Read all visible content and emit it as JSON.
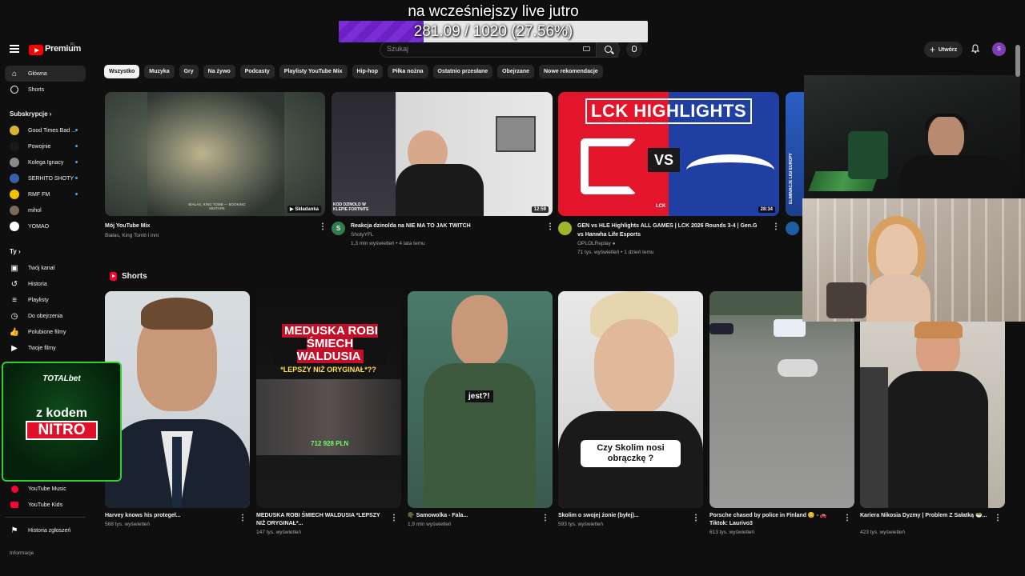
{
  "overlay": {
    "title": "na wcześniejszy live jutro",
    "progress_text": "281.09 / 1020 (27.56%)",
    "progress_fraction": 0.2756
  },
  "header": {
    "logo_text": "Premium",
    "logo_region": "PL",
    "search_placeholder": "Szukaj",
    "create_label": "Utwórz",
    "avatar_letter": "S"
  },
  "sidebar": {
    "primary": [
      {
        "label": "Główna",
        "icon": "home-icon"
      },
      {
        "label": "Shorts",
        "icon": "shorts-icon"
      }
    ],
    "subs_header": "Subskrypcje",
    "subscriptions": [
      {
        "label": "Good Times Bad ...",
        "color": "#d9b233",
        "dot": true
      },
      {
        "label": "Powojnie",
        "color": "#1a1a1a",
        "dot": true
      },
      {
        "label": "Kolega Ignacy",
        "color": "#8a8a8a",
        "dot": true
      },
      {
        "label": "SERHITO SHOTY",
        "color": "#3a5fa8",
        "dot": true
      },
      {
        "label": "RMF FM",
        "color": "#f2c200",
        "dot": true
      },
      {
        "label": "mihol",
        "color": "#7a6a5a",
        "dot": false
      },
      {
        "label": "YOMAO",
        "color": "#ffffff",
        "dot": false
      }
    ],
    "you_header": "Ty",
    "you_items": [
      {
        "label": "Twój kanał",
        "icon": "channel-icon"
      },
      {
        "label": "Historia",
        "icon": "history-icon"
      },
      {
        "label": "Playlisty",
        "icon": "playlist-icon"
      },
      {
        "label": "Do obejrzenia",
        "icon": "watch-later-icon"
      },
      {
        "label": "Polubione filmy",
        "icon": "like-icon"
      },
      {
        "label": "Twoje filmy",
        "icon": "your-videos-icon"
      }
    ],
    "more": [
      {
        "label": "YouTube Music",
        "icon": "youtube-music-icon"
      },
      {
        "label": "YouTube Kids",
        "icon": "youtube-kids-icon"
      }
    ],
    "report": "Historia zgłoszeń",
    "info": "Informacje"
  },
  "chips": [
    "Wszystko",
    "Muzyka",
    "Gry",
    "Na żywo",
    "Podcasty",
    "Playlisty YouTube Mix",
    "Hip-hop",
    "Piłka nożna",
    "Ostatnio przesłane",
    "Obejrzane",
    "Nowe rekomendacje"
  ],
  "videos": [
    {
      "title": "Mój YouTube Mix",
      "meta": "Białas, King Tomb i inni",
      "badge": "Składanka",
      "thumb_text": "BIAŁAS, KING TOMB — BOOKING MIXTAPE"
    },
    {
      "title": "Reakcja dzinolda na NIE MA TO JAK TWITCH",
      "channel": "ShotyYFL",
      "meta": "1,3 mln wyświetleń • 4 lata temu",
      "duration": "12:59",
      "thumb_text": "KOD DZINOLD W KLEPIE FORTNITE"
    },
    {
      "title_line1": "GEN vs HLE Highlights ALL GAMES | LCK 2026 Rounds 3-4 | Gen.G",
      "title_line2": "vs Hanwha Life Esports",
      "channel": "OPLOLReplay",
      "meta": "71 tys. wyświetleń • 1 dzień temu",
      "duration": "28:34",
      "thumb_heading": "LCK HIGHLIGHTS",
      "thumb_vs": "VS",
      "thumb_logo": "LCK"
    }
  ],
  "partial_thumb_text": "ELIMINACJE LIGI EUROPY",
  "shorts_header": "Shorts",
  "shorts": [
    {
      "title": "Harvey knows his protegeł...",
      "meta": "568 tys. wyświetleń"
    },
    {
      "title": "MEDUSKA ROBI ŚMIECH WALDUSIA *LEPSZY NIŻ ORYGINAŁ*...",
      "meta": "147 tys. wyświetleń",
      "thumb_heading": "MEDUSKA ROBI ŚMIECH WALDUSIA",
      "thumb_sub": "*LEPSZY NIŻ ORYGINAŁ*??",
      "thumb_money": "712 928 PLN"
    },
    {
      "title": "🪖 Samowolka - Fala...",
      "meta": "1,9 mln wyświetleń",
      "thumb_caption": "jest?!"
    },
    {
      "title": "Skolim o swojej żonie (byłej)...",
      "meta": "593 tys. wyświetleń",
      "thumb_caption": "Czy Skolim nosi obrączkę ?"
    },
    {
      "title": "Porsche chased by police in Finland 😊 - 🚗 Tiktok: Laurivo3",
      "meta": "613 tys. wyświetleń"
    },
    {
      "title": "Kariera Nikosia Dyzmy | Problem Z Sałatką 🥗...",
      "meta": "423 tys. wyświetleń"
    }
  ],
  "promo": {
    "brand": "TOTALbet",
    "line1": "z kodem",
    "line2": "NITRO"
  }
}
